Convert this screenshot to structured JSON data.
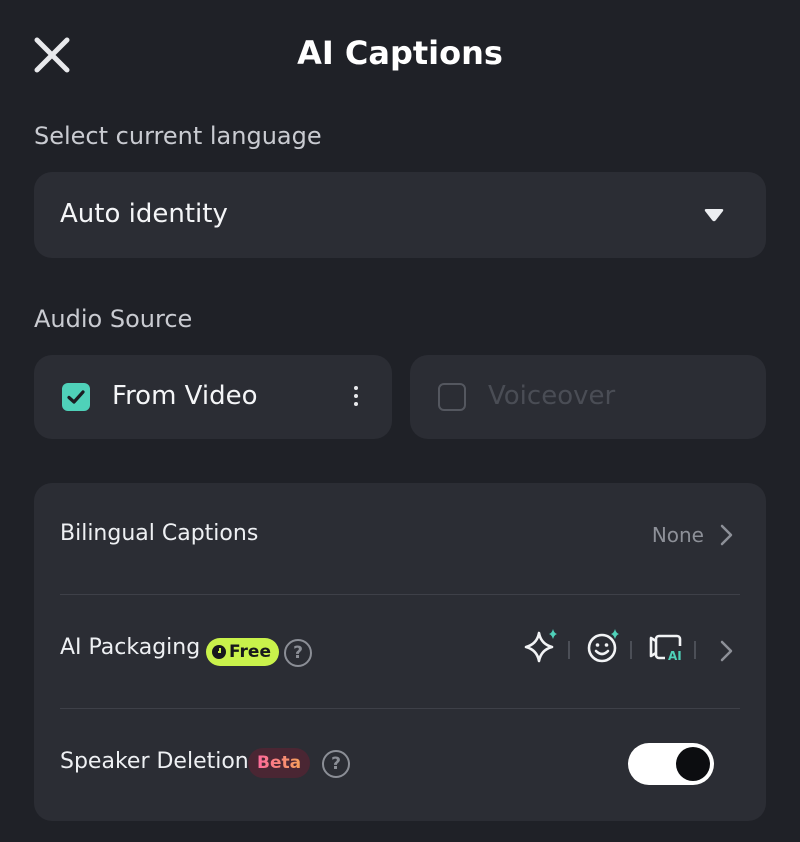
{
  "header": {
    "title": "AI Captions"
  },
  "language": {
    "label": "Select current language",
    "value": "Auto identity"
  },
  "audio": {
    "label": "Audio Source",
    "options": [
      {
        "label": "From Video",
        "checked": true
      },
      {
        "label": "Voiceover",
        "checked": false
      }
    ]
  },
  "options": {
    "bilingual": {
      "label": "Bilingual Captions",
      "value": "None"
    },
    "packaging": {
      "label": "AI Packaging",
      "badge": "Free"
    },
    "speaker": {
      "label": "Speaker Deletion",
      "badge": "Beta",
      "enabled": true
    }
  },
  "colors": {
    "accent": "#4fd1b9",
    "free_badge": "#c9f24b",
    "background": "#1f2127",
    "card": "#2b2d34"
  }
}
